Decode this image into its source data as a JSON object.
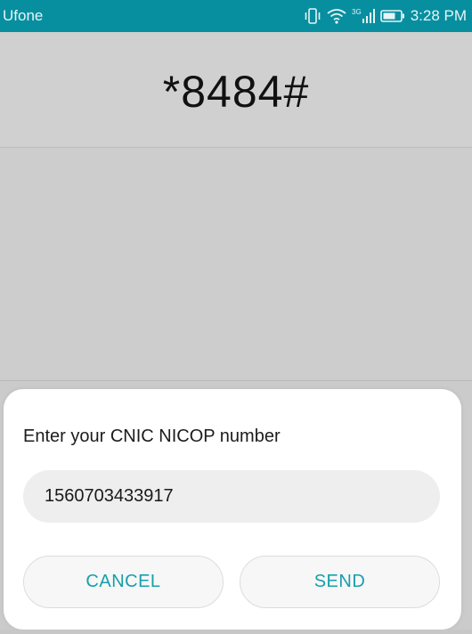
{
  "status_bar": {
    "carrier": "Ufone",
    "network_label": "3G",
    "time": "3:28 PM",
    "icons": [
      "vibrate-icon",
      "wifi-icon",
      "signal-icon",
      "battery-icon"
    ],
    "color": "#078fa0"
  },
  "dialer": {
    "ussd_code": "*8484#"
  },
  "dialog": {
    "title": "Enter your CNIC NICOP number",
    "input_value": "1560703433917",
    "cancel_label": "CANCEL",
    "send_label": "SEND",
    "accent_color": "#16a0ac"
  }
}
